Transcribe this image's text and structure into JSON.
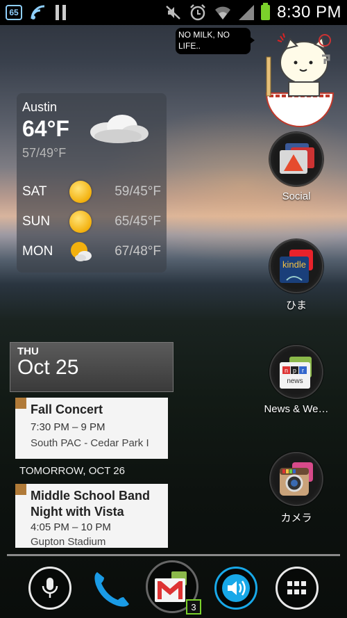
{
  "status_bar": {
    "notification_badge": "65",
    "time": "8:30 PM",
    "icons": [
      "wifi-signal-icon",
      "pause-icon",
      "mute-icon",
      "alarm-icon",
      "wifi-icon",
      "cell-signal-icon",
      "battery-icon"
    ]
  },
  "weather": {
    "city": "Austin",
    "current_temp": "64°F",
    "current_range": "57/49°F",
    "forecast": [
      {
        "day": "SAT",
        "range": "59/45°F",
        "icon": "sunny-icon"
      },
      {
        "day": "SUN",
        "range": "65/45°F",
        "icon": "sunny-icon"
      },
      {
        "day": "MON",
        "range": "67/48°F",
        "icon": "partly-cloudy-icon"
      }
    ]
  },
  "bubble": {
    "text": "NO MILK, NO LIFE.."
  },
  "apps": [
    {
      "label": "Social",
      "icon": "social-folder-icon"
    },
    {
      "label": "ひま",
      "icon": "kindle-folder-icon"
    },
    {
      "label": "News & We…",
      "icon": "npr-news-folder-icon"
    },
    {
      "label": "カメラ",
      "icon": "instagram-folder-icon"
    }
  ],
  "calendar": {
    "day_of_week": "THU",
    "date": "Oct 25",
    "tomorrow_label": "TOMORROW, OCT 26",
    "events": [
      {
        "title": "Fall Concert",
        "time": "7:30 PM – 9 PM",
        "location": "South PAC - Cedar Park I"
      },
      {
        "title": "Middle School Band Night with Vista",
        "time": "4:05 PM – 10 PM",
        "location": "Gupton Stadium"
      }
    ]
  },
  "dock": {
    "gmail_badge": "3",
    "buttons": [
      "microphone-icon",
      "phone-icon",
      "gmail-icon",
      "volume-icon",
      "app-drawer-icon"
    ]
  },
  "colors": {
    "battery": "#7bd12b",
    "accent_blue": "#18a8e8",
    "status_bar": "#000000"
  }
}
